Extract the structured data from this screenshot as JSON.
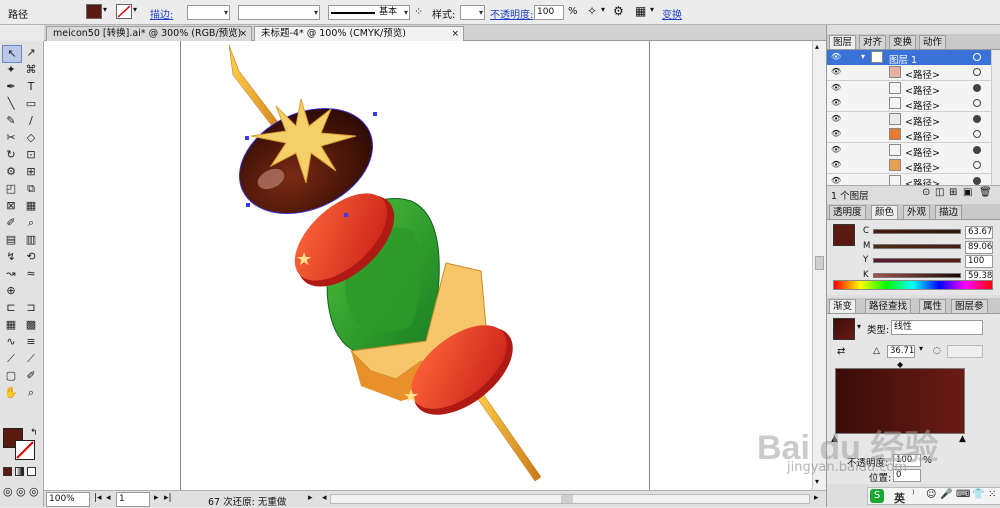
{
  "control_bar": {
    "selection_type": "路径",
    "stroke_label": "描边:",
    "basic_label": "基本",
    "style_label": "样式:",
    "opacity_label": "不透明度:",
    "opacity_value": "100",
    "percent": "%",
    "transform_label": "变换",
    "fill_color": "#5a1a12"
  },
  "tabs": [
    {
      "label": "meicon50 [转换].ai* @ 300% (RGB/预览)",
      "active": false
    },
    {
      "label": "未标题-4* @ 100% (CMYK/预览)",
      "active": true
    }
  ],
  "tab_close": "×",
  "tools": [
    "↖",
    "↗",
    "✦",
    "⌘",
    "✒",
    "T",
    "╲",
    "▭",
    "✎",
    "/",
    "✂",
    "◇",
    "↻",
    "⊡",
    "⚙",
    "⊞",
    "◰",
    "⧉",
    "⊠",
    "▦",
    "✐",
    "⌕",
    "▤",
    "▥",
    "↯",
    "⟲",
    "↝",
    "≈",
    "⊕",
    "",
    "⊏",
    "⊐",
    "▦",
    "▩",
    "∿",
    "≡",
    "⟋",
    "⟋",
    "▢",
    "✐",
    "✋",
    "⌕"
  ],
  "tool_colors": {
    "fill": "#5a1a12",
    "stroke": "none"
  },
  "status": {
    "zoom": "100%",
    "page": "1",
    "undo_text": "67 次还原: 无重做"
  },
  "layers_panel": {
    "tabs": [
      "图层",
      "对齐",
      "变换",
      "动作"
    ],
    "layer_name": "图层 1",
    "rows": [
      "<路径>",
      "<路径>",
      "<路径>",
      "<路径>",
      "<路径>",
      "<路径>",
      "<路径>",
      "<路径>"
    ],
    "footer": "1 个图层"
  },
  "color_panel": {
    "tabs": [
      "透明度",
      "颜色",
      "外观",
      "描边"
    ],
    "channels": [
      {
        "label": "C",
        "value": "63.67"
      },
      {
        "label": "M",
        "value": "89.06"
      },
      {
        "label": "Y",
        "value": "100"
      },
      {
        "label": "K",
        "value": "59.38"
      }
    ]
  },
  "gradient_panel": {
    "tabs": [
      "渐变",
      "路径查找",
      "属性",
      "图层参"
    ],
    "type_label": "类型:",
    "type_value": "线性",
    "angle": "36.71",
    "opacity_label": "不透明度:",
    "opacity_value": "100",
    "position_label": "位置:",
    "position_value": "0",
    "colors": [
      "#3a0c08",
      "#6a1c14"
    ]
  },
  "watermark": {
    "brand": "Bai du 经验",
    "url": "jingyan.baidu.com"
  },
  "ime": {
    "mode": "英"
  }
}
